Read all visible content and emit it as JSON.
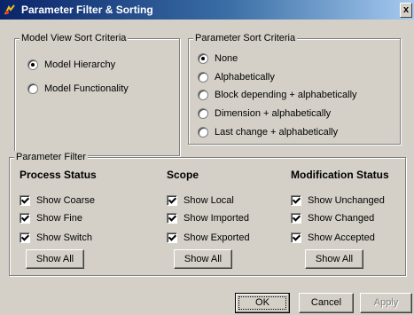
{
  "window": {
    "title": "Parameter Filter & Sorting",
    "close_glyph": "x"
  },
  "model_view": {
    "legend": "Model View Sort Criteria",
    "options": [
      {
        "label": "Model Hierarchy",
        "checked": true
      },
      {
        "label": "Model Functionality",
        "checked": false
      }
    ]
  },
  "param_sort": {
    "legend": "Parameter Sort Criteria",
    "options": [
      {
        "label": "None",
        "checked": true
      },
      {
        "label": "Alphabetically",
        "checked": false
      },
      {
        "label": "Block depending + alphabetically",
        "checked": false
      },
      {
        "label": "Dimension + alphabetically",
        "checked": false
      },
      {
        "label": "Last change + alphabetically",
        "checked": false
      }
    ]
  },
  "param_filter": {
    "legend": "Parameter Filter",
    "columns": [
      {
        "header": "Process Status",
        "items": [
          "Show Coarse",
          "Show Fine",
          "Show Switch"
        ],
        "show_all": "Show All"
      },
      {
        "header": "Scope",
        "items": [
          "Show Local",
          "Show Imported",
          "Show Exported"
        ],
        "show_all": "Show All"
      },
      {
        "header": "Modification Status",
        "items": [
          "Show Unchanged",
          "Show Changed",
          "Show Accepted"
        ],
        "show_all": "Show All"
      }
    ]
  },
  "footer": {
    "ok": "OK",
    "cancel": "Cancel",
    "apply": "Apply"
  },
  "icons": {
    "app": "app-icon",
    "radio": "radio-icon",
    "checkbox": "checkbox-icon"
  }
}
